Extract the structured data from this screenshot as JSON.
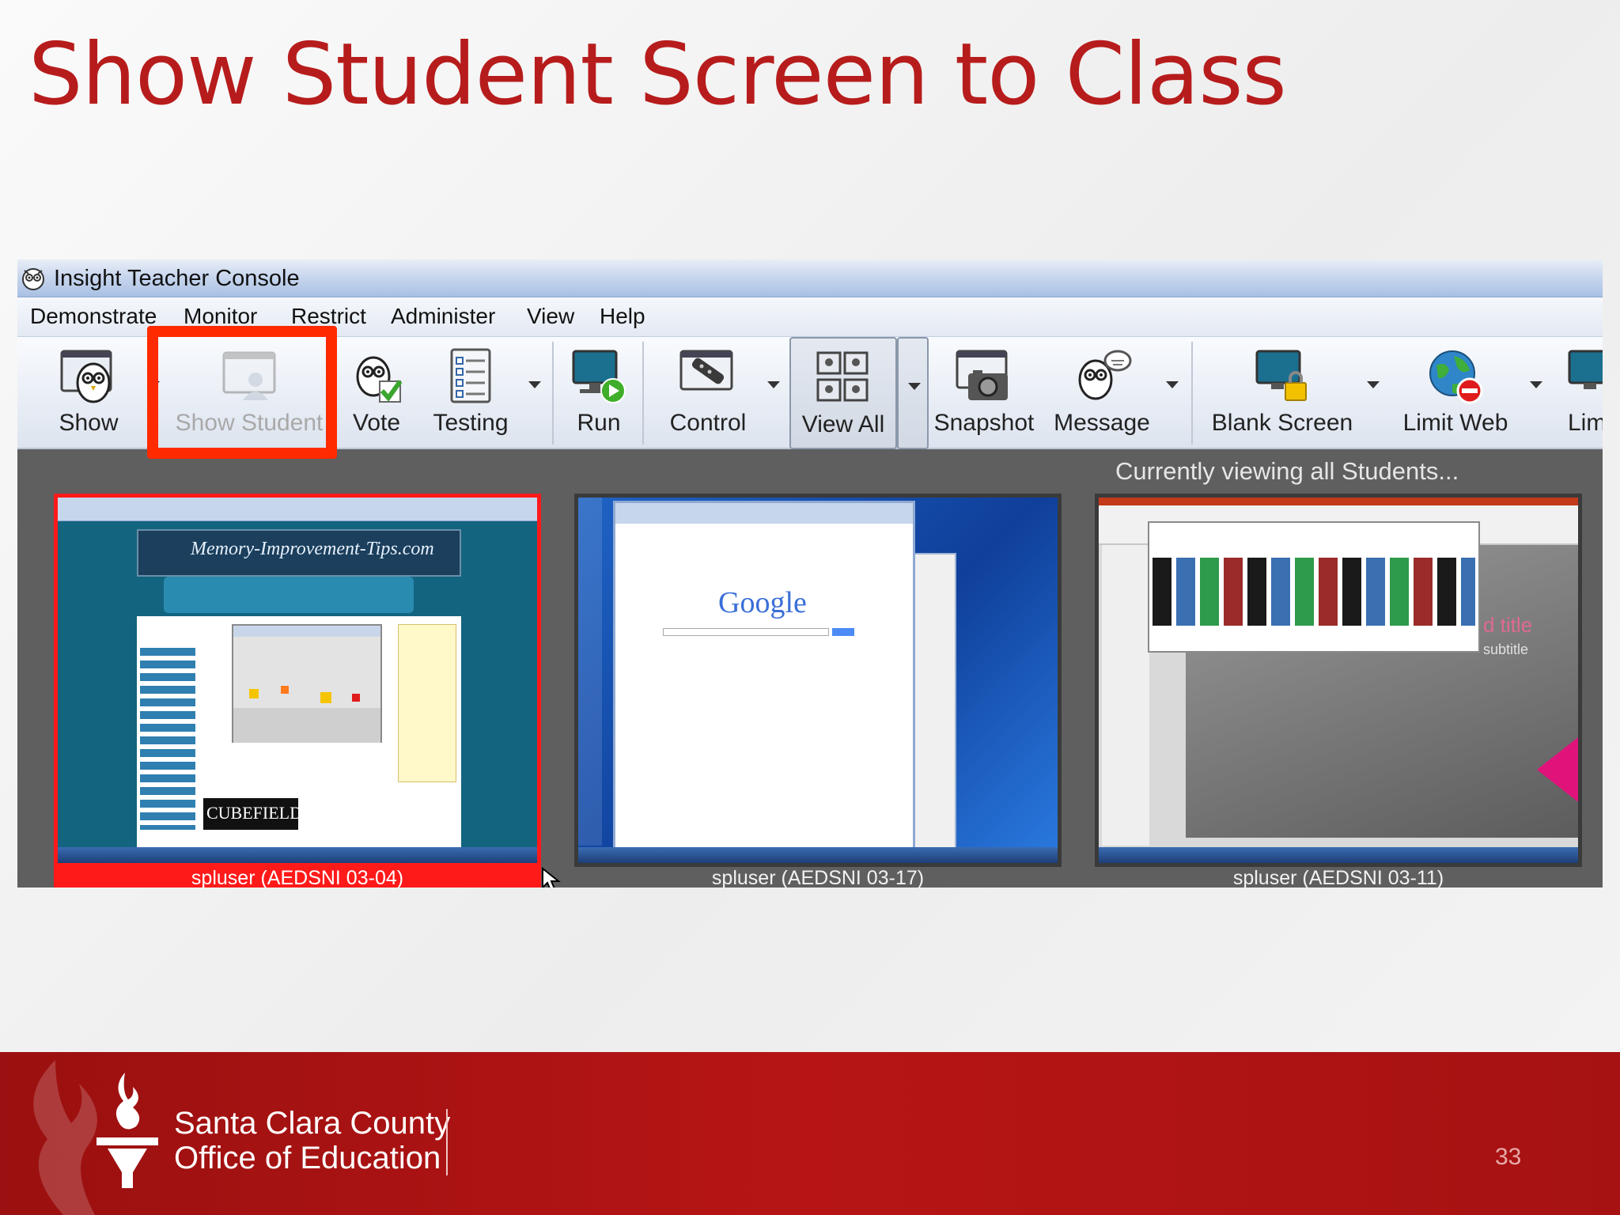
{
  "slide": {
    "title": "Show Student Screen to Class",
    "page_number": "33"
  },
  "window": {
    "title": "Insight Teacher Console",
    "app_icon": "owl-icon"
  },
  "menu": [
    "Demonstrate",
    "Monitor",
    "Restrict",
    "Administer",
    "View",
    "Help"
  ],
  "toolbar": [
    {
      "label": "Show",
      "icon": "owl-screen-icon",
      "dropdown": true,
      "state": "normal"
    },
    {
      "label": "Show Student",
      "icon": "student-screen-icon",
      "dropdown": false,
      "state": "disabled"
    },
    {
      "label": "Vote",
      "icon": "owl-check-icon",
      "dropdown": false,
      "state": "normal"
    },
    {
      "label": "Testing",
      "icon": "checklist-icon",
      "dropdown": true,
      "state": "normal"
    },
    {
      "label": "Run",
      "icon": "monitor-play-icon",
      "dropdown": false,
      "state": "normal"
    },
    {
      "label": "Control",
      "icon": "remote-control-icon",
      "dropdown": true,
      "state": "normal"
    },
    {
      "label": "View All",
      "icon": "grid-monitors-icon",
      "dropdown": true,
      "state": "pressed"
    },
    {
      "label": "Snapshot",
      "icon": "camera-icon",
      "dropdown": false,
      "state": "normal"
    },
    {
      "label": "Message",
      "icon": "owl-speech-icon",
      "dropdown": true,
      "state": "normal"
    },
    {
      "label": "Blank Screen",
      "icon": "monitor-lock-icon",
      "dropdown": true,
      "state": "normal"
    },
    {
      "label": "Limit Web",
      "icon": "globe-block-icon",
      "dropdown": true,
      "state": "normal"
    },
    {
      "label": "Limit",
      "icon": "monitor-icon",
      "dropdown": false,
      "state": "normal"
    }
  ],
  "students_view": {
    "status": "Currently viewing all Students...",
    "students": [
      {
        "label": "spluser (AEDSNI 03-04)",
        "selected": true,
        "screen": "browser-memory-improvement-tips"
      },
      {
        "label": "spluser (AEDSNI 03-17)",
        "selected": false,
        "screen": "browser-google"
      },
      {
        "label": "spluser (AEDSNI 03-11)",
        "selected": false,
        "screen": "powerpoint-themes"
      }
    ],
    "thumb_text": {
      "site_title": "Memory-Improvement-Tips.com",
      "cubefield": "CUBEFIELD",
      "google": "Google",
      "slide_title": "d title",
      "slide_subtitle": "subtitle"
    }
  },
  "footer": {
    "org_line1": "Santa Clara County",
    "org_line2": "Office of Education",
    "logo": "torch-flame-icon"
  },
  "colors": {
    "title_red": "#b71c1c",
    "highlight_red": "#ff2a00",
    "footer_red": "#b01414",
    "selected_tile_red": "#ff1a1a"
  }
}
